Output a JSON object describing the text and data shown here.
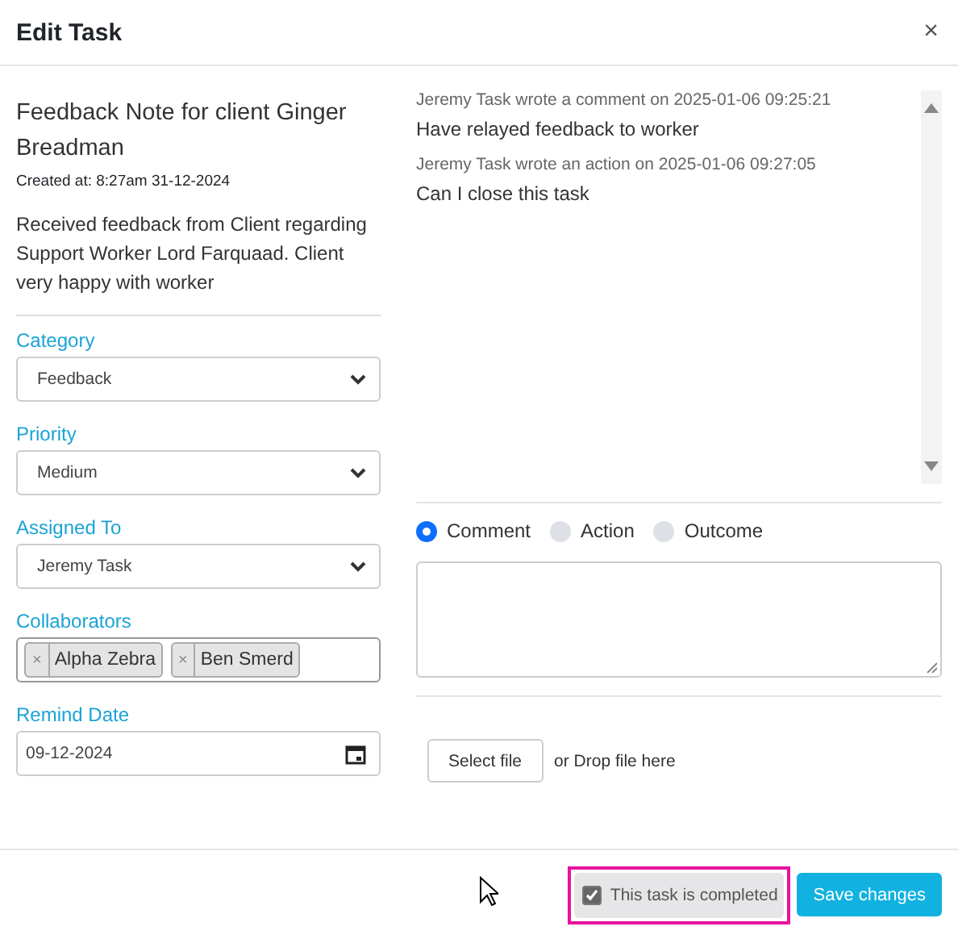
{
  "dialog": {
    "title": "Edit Task",
    "close": "×"
  },
  "task": {
    "title": "Feedback Note for client Ginger Breadman",
    "created": "Created at: 8:27am 31-12-2024",
    "description": "Received feedback from Client regarding Support Worker Lord Farquaad. Client very happy with worker"
  },
  "fields": [
    {
      "label": "Category",
      "kind": "select",
      "value": "Feedback"
    },
    {
      "label": "Priority",
      "kind": "select",
      "value": "Medium"
    },
    {
      "label": "Assigned To",
      "kind": "select",
      "value": "Jeremy Task"
    },
    {
      "label": "Collaborators",
      "kind": "tags",
      "tags": [
        "Alpha Zebra",
        "Ben Smerd"
      ],
      "remove": "×"
    },
    {
      "label": "Remind Date",
      "kind": "date",
      "value": "09-12-2024"
    }
  ],
  "comments": [
    {
      "meta": "Jeremy Task wrote a comment on 2025-01-06 09:25:21",
      "text": "Have relayed feedback to worker"
    },
    {
      "meta": "Jeremy Task wrote an action on 2025-01-06 09:27:05",
      "text": "Can I close this task"
    }
  ],
  "entry_types": [
    {
      "label": "Comment",
      "selected": true
    },
    {
      "label": "Action",
      "selected": false
    },
    {
      "label": "Outcome",
      "selected": false
    }
  ],
  "upload": {
    "button": "Select file",
    "hint": "or Drop file here"
  },
  "footer": {
    "completed": {
      "label": "This task is completed",
      "checked": true,
      "highlighted": true
    },
    "save": "Save changes"
  }
}
